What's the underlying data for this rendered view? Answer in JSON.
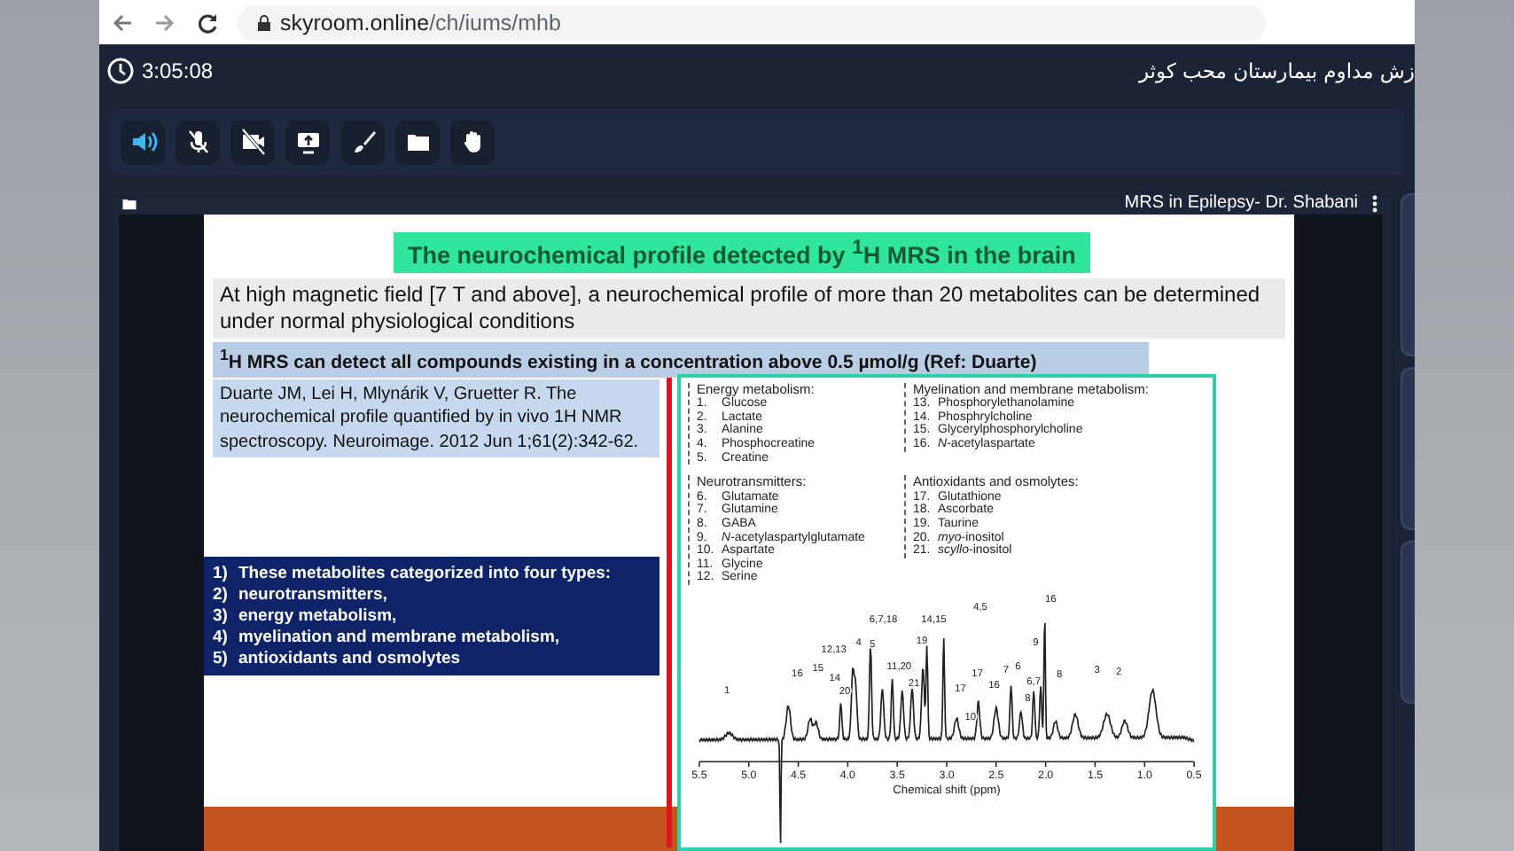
{
  "browser": {
    "url_host": "skyroom.online",
    "url_path": "/ch/iums/mhb"
  },
  "header": {
    "clock": "3:05:08",
    "title": "زش مداوم بیمارستان محب کوثر"
  },
  "toolbar": [
    {
      "kind": "speaker",
      "active": true
    },
    {
      "kind": "mic-off",
      "active": false
    },
    {
      "kind": "camera-off",
      "active": false
    },
    {
      "kind": "screen",
      "active": false
    },
    {
      "kind": "brush",
      "active": false
    },
    {
      "kind": "folder",
      "active": false
    },
    {
      "kind": "hand",
      "active": false
    }
  ],
  "presentation": {
    "title": "MRS in Epilepsy- Dr. Shabani"
  },
  "slide": {
    "title": "The neurochemical profile detected by $^{1}$H MRS in the brain",
    "intro": "At high magnetic field [7 T and above], a neurochemical profile of more than 20 metabolites can be determined under normal physiological conditions",
    "note": "$^{1}$H MRS can detect all compounds existing in a concentration above 0.5 µmol/g (Ref: Duarte)",
    "citation": "Duarte JM, Lei H, Mlynárik V, Gruetter R. The neurochemical profile quantified by in vivo 1H NMR spectroscopy. Neuroimage. 2012 Jun 1;61(2):342-62.",
    "list": [
      {
        "num": "1)",
        "text": "These metabolites categorized into four types:"
      },
      {
        "num": "2)",
        "text": "neurotransmitters,"
      },
      {
        "num": "3)",
        "text": "energy metabolism,"
      },
      {
        "num": "4)",
        "text": "myelination and membrane metabolism,"
      },
      {
        "num": "5)",
        "text": "antioxidants and osmolytes"
      }
    ],
    "figure": {
      "legends": [
        {
          "heading": "Energy metabolism:",
          "items": [
            {
              "num": "1.",
              "name": "Glucose"
            },
            {
              "num": "2.",
              "name": "Lactate"
            },
            {
              "num": "3.",
              "name": "Alanine"
            },
            {
              "num": "4.",
              "name": "Phosphocreatine"
            },
            {
              "num": "5.",
              "name": "Creatine"
            }
          ]
        },
        {
          "heading": "Myelination and membrane metabolism:",
          "items": [
            {
              "num": "13.",
              "name": "Phosphorylethanolamine"
            },
            {
              "num": "14.",
              "name": "Phosphrylcholine"
            },
            {
              "num": "15.",
              "name": "Glycerylphosphorylcholine"
            },
            {
              "num": "16.",
              "name": "*N*-acetylaspartate"
            }
          ]
        },
        {
          "heading": "Neurotransmitters:",
          "items": [
            {
              "num": "6.",
              "name": "Glutamate"
            },
            {
              "num": "7.",
              "name": "Glutamine"
            },
            {
              "num": "8.",
              "name": "GABA"
            },
            {
              "num": "9.",
              "name": "*N*-acetylaspartylglutamate"
            },
            {
              "num": "10.",
              "name": "Aspartate"
            },
            {
              "num": "11.",
              "name": "Glycine"
            },
            {
              "num": "12.",
              "name": "Serine"
            }
          ]
        },
        {
          "heading": "Antioxidants and osmolytes:",
          "items": [
            {
              "num": "17.",
              "name": "Glutathione"
            },
            {
              "num": "18.",
              "name": "Ascorbate"
            },
            {
              "num": "19.",
              "name": "Taurine"
            },
            {
              "num": "20.",
              "name": "*myo*-inositol"
            },
            {
              "num": "21.",
              "name": "*scyllo*-inositol"
            }
          ]
        }
      ],
      "spectrum": {
        "peak_labels": [
          "1",
          "16",
          "15",
          "14",
          "20",
          "12,13",
          "4",
          "5",
          "6,7,18",
          "11,20",
          "19",
          "21",
          "14,15",
          "4,5",
          "17",
          "10",
          "17",
          "16",
          "7",
          "6",
          "8",
          "9",
          "6,7",
          "16",
          "8",
          "3",
          "2"
        ],
        "x_ticks": [
          "5.5",
          "5.0",
          "4.5",
          "4.0",
          "3.5",
          "3.0",
          "2.5",
          "2.0",
          "1.5",
          "1.0",
          "0.5"
        ],
        "x_label": "Chemical shift (ppm)"
      }
    }
  }
}
